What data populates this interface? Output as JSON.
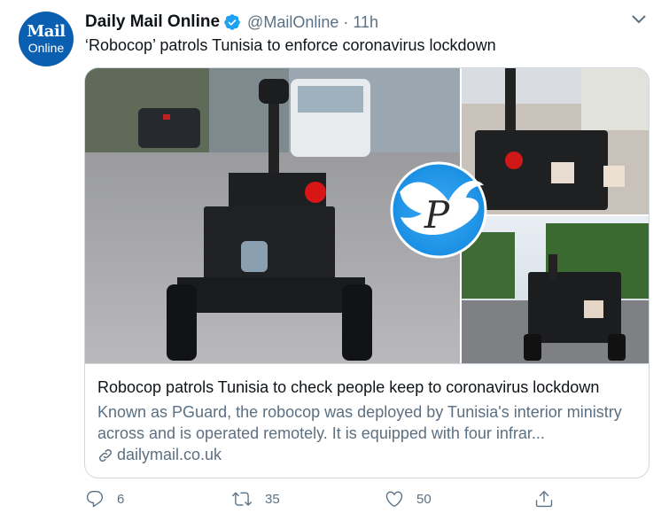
{
  "account": {
    "avatar_line1": "Mail",
    "avatar_line2": "Online",
    "name": "Daily Mail Online",
    "handle": "@MailOnline",
    "separator": "·",
    "time": "11h"
  },
  "tweet": {
    "text": "‘Robocop’ patrols Tunisia to enforce coronavirus lockdown"
  },
  "card": {
    "title": "Robocop patrols Tunisia to check people keep to coronavirus lockdown",
    "description": "Known as PGuard, the robocop was deployed by Tunisia's interior ministry across and is operated remotely. It is equipped with four infrar...",
    "domain": "dailymail.co.uk",
    "watermark_letter": "P"
  },
  "actions": {
    "replies": "6",
    "retweets": "35",
    "likes": "50"
  },
  "colors": {
    "text": "#0f1419",
    "secondary": "#5b7083",
    "verified": "#1da1f2",
    "border": "#cfd9de",
    "avatar_bg": "#0b5fb0"
  },
  "icons": [
    "verified-badge-icon",
    "caret-down-icon",
    "link-icon",
    "reply-icon",
    "retweet-icon",
    "like-icon",
    "share-icon",
    "twitter-bird-icon"
  ]
}
